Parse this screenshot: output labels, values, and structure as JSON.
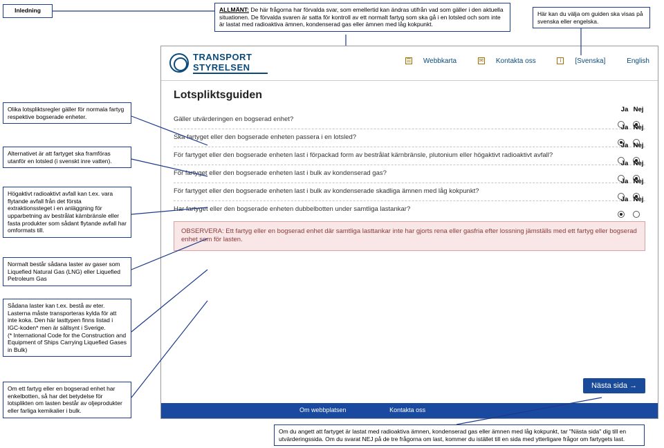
{
  "callouts": {
    "inledning": "Inledning",
    "allmant_label": "ALLMÄNT:",
    "allmant_text": " De här frågorna har förvalda svar, som emellertid kan ändras utifrån vad som gäller i den aktuella situationen. De förvalda svaren är satta för kontroll av ett normalt fartyg som ska gå i en lotsled och som inte är lastat med radioaktiva ämnen, kondenserad gas eller ämnen med låg kokpunkt.",
    "lang_text": "Här kan du välja om guiden ska visas på svenska eller engelska.",
    "c1": "Olika lotspliktsregler gäller för normala fartyg respektive bogserade enheter.",
    "c2": "Alternativet är att fartyget ska framföras utanför en lotsled (i svenskt inre vatten).",
    "c3": "Högaktivt radioaktivt avfall kan t.ex. vara flytande avfall från det första extraktionssteget i en anläggning för upparbetning av bestrålat kärnbränsle eller fasta produkter som sådant flytande avfall har omformats till.",
    "c4": "Normalt består sådana laster av gaser som Liquefied Natural Gas (LNG) eller Liquefied Petroleum Gas",
    "c5": "Sådana laster kan t.ex. bestå av eter. Lasterna måste transporteras kylda för att inte koka. Den här lasttypen finns listad i IGC-koden* men är sällsynt i Sverige.\n(* International Code for the Construction and Equipment of Ships Carrying Liquefied Gases in Bulk)",
    "c6": "Om ett fartyg eller en bogserad enhet har enkelbotten, så har det betydelse för lotsplikten om lasten består av oljeprodukter eller farliga kemikalier i bulk.",
    "bottom": "Om du angett att fartyget är lastat med radioaktiva ämnen, kondenserad gas eller ämnen med låg kokpunkt, tar \"Nästa sida\" dig till en utvärderingssida. Om du svarat NEJ på de tre frågorna om last, kommer du istället till en sida med ytterligare frågor om fartygets last."
  },
  "header": {
    "logo1": "TRANSPORT",
    "logo2": "STYRELSEN",
    "webbkarta": "Webbkarta",
    "kontakta": "Kontakta oss",
    "svenska": "[Svenska]",
    "english": "English"
  },
  "page": {
    "title": "Lotspliktsguiden",
    "ja": "Ja",
    "nej": "Nej",
    "q1": "Gäller utvärderingen en bogserad enhet?",
    "q2": "Ska fartyget eller den bogserade enheten passera i en lotsled?",
    "q3": "För fartyget eller den bogserade enheten last i förpackad form av bestrålat kärnbränsle, plutonium eller högaktivt radioaktivt avfall?",
    "q4": "För fartyget eller den bogserade enheten last i bulk av kondenserad gas?",
    "q5": "För fartyget eller den bogserade enheten last i bulk av kondenserade skadliga ämnen med låg kokpunkt?",
    "q6": "Har fartyget eller den bogserade enheten dubbelbotten under samtliga lastankar?",
    "notice": "OBSERVERA: Ett fartyg eller en bogserad enhet där samtliga lasttankar inte har gjorts rena eller gasfria efter lossning jämställs med ett fartyg eller bogserad enhet som för lasten.",
    "next": "Nästa sida →",
    "foot1": "Om webbplatsen",
    "foot2": "Kontakta oss"
  }
}
